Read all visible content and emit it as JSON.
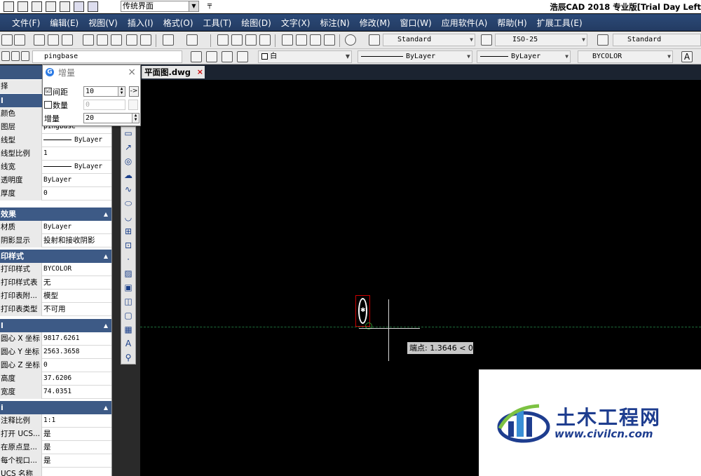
{
  "window": {
    "app_title": "浩辰CAD 2018 专业版[Trial Day Left",
    "workspace": "传统界面"
  },
  "menu": [
    "文件(F)",
    "编辑(E)",
    "视图(V)",
    "插入(I)",
    "格式(O)",
    "工具(T)",
    "绘图(D)",
    "文字(X)",
    "标注(N)",
    "修改(M)",
    "窗口(W)",
    "应用软件(A)",
    "帮助(H)",
    "扩展工具(E)"
  ],
  "toolbar": {
    "text_style": "Standard",
    "dim_style": "ISO-25",
    "table_style": "Standard",
    "layer": "pingbase",
    "color": "白",
    "linetype": "ByLayer",
    "lineweight": "ByLayer",
    "plotstyle": "BYCOLOR"
  },
  "doc_tab": {
    "label": "平面图.dwg",
    "close": "×"
  },
  "increment_dialog": {
    "title": "增量",
    "spacing_label": "间距",
    "spacing_value": "10",
    "spacing_checked": "☑",
    "count_label": "数量",
    "count_value": "0",
    "increment_label": "增量",
    "increment_value": "20",
    "arrow_button": "->",
    "close": "×"
  },
  "properties": {
    "select_label": "择",
    "sections": {
      "general": "l",
      "effects": "效果",
      "plot": "印样式",
      "geometry": "l",
      "misc": "i"
    },
    "rows": [
      {
        "k": "颜色",
        "v": ""
      },
      {
        "k": "图层",
        "v": "pingbase"
      },
      {
        "k": "线型",
        "v": "ByLayer"
      },
      {
        "k": "线型比例",
        "v": "1"
      },
      {
        "k": "线宽",
        "v": "ByLayer"
      },
      {
        "k": "透明度",
        "v": "ByLayer"
      },
      {
        "k": "厚度",
        "v": "0"
      },
      {
        "k": "材质",
        "v": "ByLayer"
      },
      {
        "k": "阴影显示",
        "v": "投射和接收阴影"
      },
      {
        "k": "打印样式",
        "v": "BYCOLOR"
      },
      {
        "k": "打印样式表",
        "v": "无"
      },
      {
        "k": "打印表附...",
        "v": "模型"
      },
      {
        "k": "打印表类型",
        "v": "不可用"
      },
      {
        "k": "圆心 X 坐标",
        "v": "9817.6261"
      },
      {
        "k": "圆心 Y 坐标",
        "v": "2563.3658"
      },
      {
        "k": "圆心 Z 坐标",
        "v": "0"
      },
      {
        "k": "高度",
        "v": "37.6206"
      },
      {
        "k": "宽度",
        "v": "74.0351"
      },
      {
        "k": "注释比例",
        "v": "1:1"
      },
      {
        "k": "打开 UCS...",
        "v": "是"
      },
      {
        "k": "在原点显...",
        "v": "是"
      },
      {
        "k": "每个视口...",
        "v": "是"
      },
      {
        "k": "UCS 名称",
        "v": ""
      }
    ]
  },
  "canvas": {
    "tooltip": "端点: 1.3646 < 0°"
  },
  "watermark": {
    "name": "土木工程网",
    "url": "www.civilcn.com"
  },
  "colors": {
    "menubar": "#2c4a78",
    "section": "#3d5a86",
    "selection": "#cc0000",
    "axis": "#1f6f3b",
    "watermark_text": "#1e3d8f"
  }
}
